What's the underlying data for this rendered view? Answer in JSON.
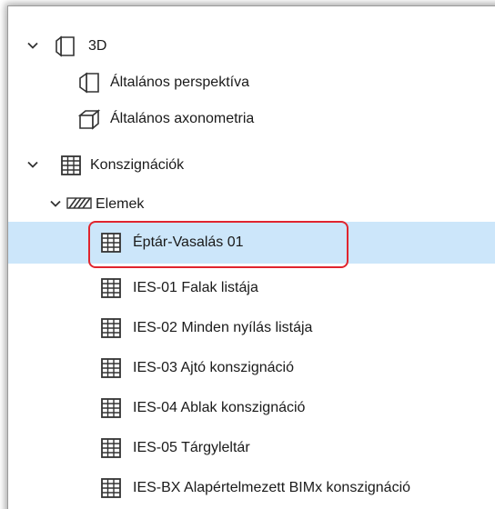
{
  "tree": {
    "group_3d": {
      "label": "3D",
      "expanded": true,
      "items": [
        {
          "label": "Általános perspektíva",
          "icon": "perspective-icon"
        },
        {
          "label": "Általános axonometria",
          "icon": "axonometry-icon"
        }
      ]
    },
    "group_schedules": {
      "label": "Konszignációk",
      "expanded": true,
      "subgroup": {
        "label": "Elemek",
        "expanded": true,
        "items": [
          {
            "label": "Éptár-Vasalás 01",
            "selected": true
          },
          {
            "label": "IES-01 Falak listája"
          },
          {
            "label": "IES-02 Minden nyílás listája"
          },
          {
            "label": "IES-03 Ajtó konszignáció"
          },
          {
            "label": "IES-04 Ablak konszignáció"
          },
          {
            "label": "IES-05 Tárgyleltár"
          },
          {
            "label": "IES-BX Alapértelmezett BIMx konszignáció"
          }
        ]
      }
    }
  },
  "colors": {
    "selection_bg": "#cce6fa",
    "highlight_border": "#e0252e"
  }
}
